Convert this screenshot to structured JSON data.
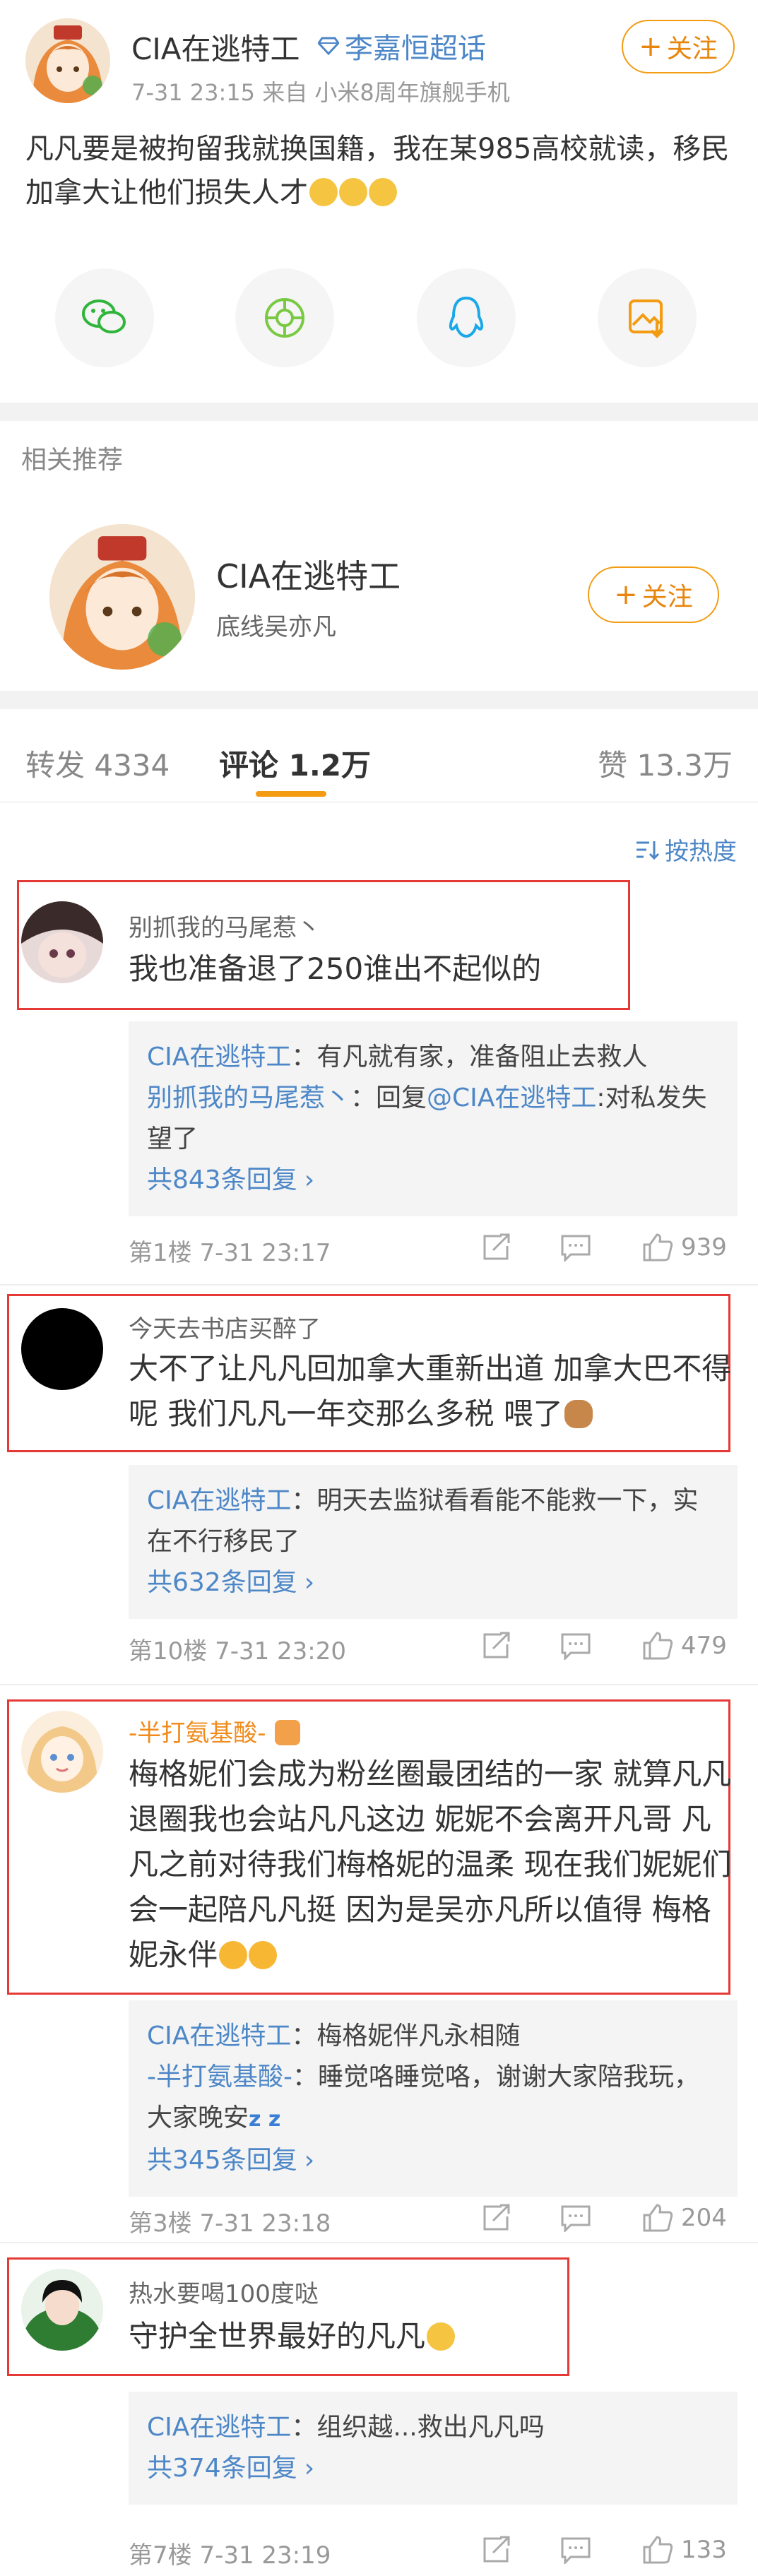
{
  "post": {
    "user_name": "CIA在逃特工",
    "vip_icon": "diamond-icon",
    "vip_label": "李嘉恒超话",
    "meta": "7-31 23:15  来自 小米8周年旗舰手机",
    "follow_label": "关注",
    "content": "凡凡要是被拘留我就换国籍，我在某985高校就读，移民加拿大让他们损失人才"
  },
  "share": {
    "icons": [
      "wechat-icon",
      "moments-icon",
      "qq-icon",
      "save-image-icon"
    ],
    "colors": {
      "wechat": "#2fb53a",
      "moments": "#7ac943",
      "qq": "#1ba8e8",
      "save": "#f39c12"
    }
  },
  "related": {
    "title": "相关推荐",
    "user_name": "CIA在逃特工",
    "desc": "底线吴亦凡",
    "follow_label": "关注"
  },
  "tabs": {
    "repost": "转发 4334",
    "comments": "评论 1.2万",
    "likes": "赞 13.3万"
  },
  "sort_label": "按热度",
  "accent": "#f39c12",
  "link_color": "#4d87c7",
  "highlight_color": "#e53935",
  "comments": [
    {
      "user": "别抓我的马尾惹丶",
      "text": "我也准备退了250谁出不起似的",
      "replies": [
        {
          "name": "CIA在逃特工",
          "text": "：有凡就有家，准备阻止去救人"
        },
        {
          "name": "别抓我的马尾惹丶",
          "text": "：回复",
          "mention": "@CIA在逃特工",
          "text2": ":对私发失望了"
        }
      ],
      "more": "共843条回复",
      "floor": "第1楼 7-31 23:17",
      "likes": "939"
    },
    {
      "user": "今天去书店买醉了",
      "text": "大不了让凡凡回加拿大重新出道 加拿大巴不得呢 我们凡凡一年交那么多税 喂了",
      "replies": [
        {
          "name": "CIA在逃特工",
          "text": "：明天去监狱看看能不能救一下，实在不行移民了"
        }
      ],
      "more": "共632条回复",
      "floor": "第10楼 7-31 23:20",
      "likes": "479"
    },
    {
      "user": "-半打氨基酸-",
      "text": "梅格妮们会成为粉丝圈最团结的一家 就算凡凡退圈我也会站凡凡这边 妮妮不会离开凡哥  凡凡之前对待我们梅格妮的温柔 现在我们妮妮们会一起陪凡凡挺 因为是吴亦凡所以值得 梅格妮永伴",
      "replies": [
        {
          "name": "CIA在逃特工",
          "text": "：梅格妮伴凡永相随"
        },
        {
          "name": "-半打氨基酸-",
          "text": "：睡觉咯睡觉咯，谢谢大家陪我玩，大家晚安"
        }
      ],
      "more": "共345条回复",
      "floor": "第3楼 7-31 23:18",
      "likes": "204"
    },
    {
      "user": "热水要喝100度哒",
      "text": "守护全世界最好的凡凡",
      "replies": [
        {
          "name": "CIA在逃特工",
          "text": "：组织越...救出凡凡吗"
        }
      ],
      "more": "共374条回复",
      "floor": "第7楼 7-31 23:19",
      "likes": "133"
    }
  ]
}
